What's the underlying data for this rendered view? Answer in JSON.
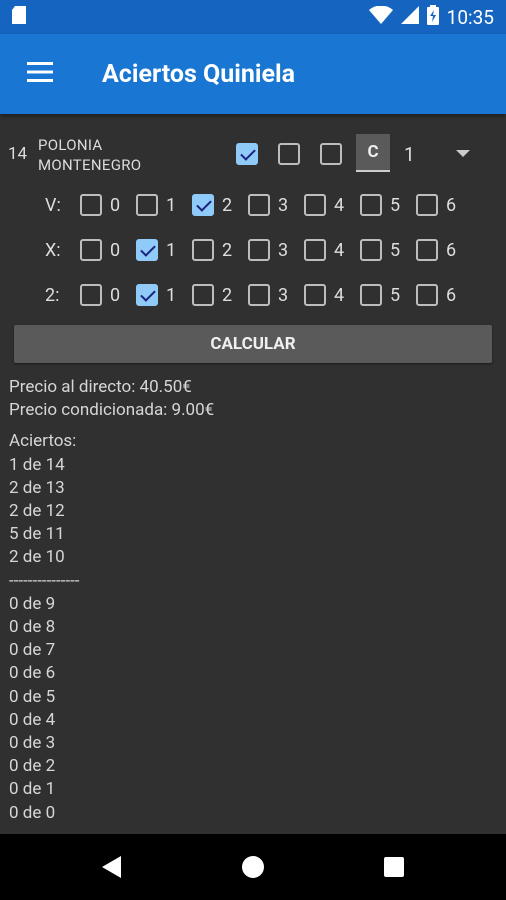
{
  "status": {
    "time": "10:35"
  },
  "app": {
    "title": "Aciertos Quiniela"
  },
  "match": {
    "number": "14",
    "home": "POLONIA",
    "away": "MONTENEGRO",
    "signs": {
      "one": true,
      "x": false,
      "two": false
    },
    "c_label": "C",
    "spinner_value": "1"
  },
  "grid": {
    "rows": [
      {
        "label": "V:",
        "checked": [
          false,
          false,
          true,
          false,
          false,
          false,
          false
        ]
      },
      {
        "label": "X:",
        "checked": [
          false,
          true,
          false,
          false,
          false,
          false,
          false
        ]
      },
      {
        "label": "2:",
        "checked": [
          false,
          true,
          false,
          false,
          false,
          false,
          false
        ]
      }
    ],
    "numbers": [
      "0",
      "1",
      "2",
      "3",
      "4",
      "5",
      "6"
    ]
  },
  "calc_label": "CALCULAR",
  "results": {
    "lines": [
      "Precio al directo: 40.50€",
      "Precio condicionada: 9.00€",
      "Aciertos:",
      "1 de 14",
      "2 de 13",
      "2 de 12",
      "5 de 11",
      "2 de 10",
      "---------------",
      "0 de 9",
      "0 de 8",
      "0 de 7",
      "0 de 6",
      "0 de 5",
      "0 de 4",
      "0 de 3",
      "0 de 2",
      "0 de 1",
      "0 de 0"
    ]
  },
  "colors": {
    "statusbar": "#1565c0",
    "appbar": "#1976d2",
    "background": "#303030",
    "checkbox_on": "#90caf9"
  }
}
